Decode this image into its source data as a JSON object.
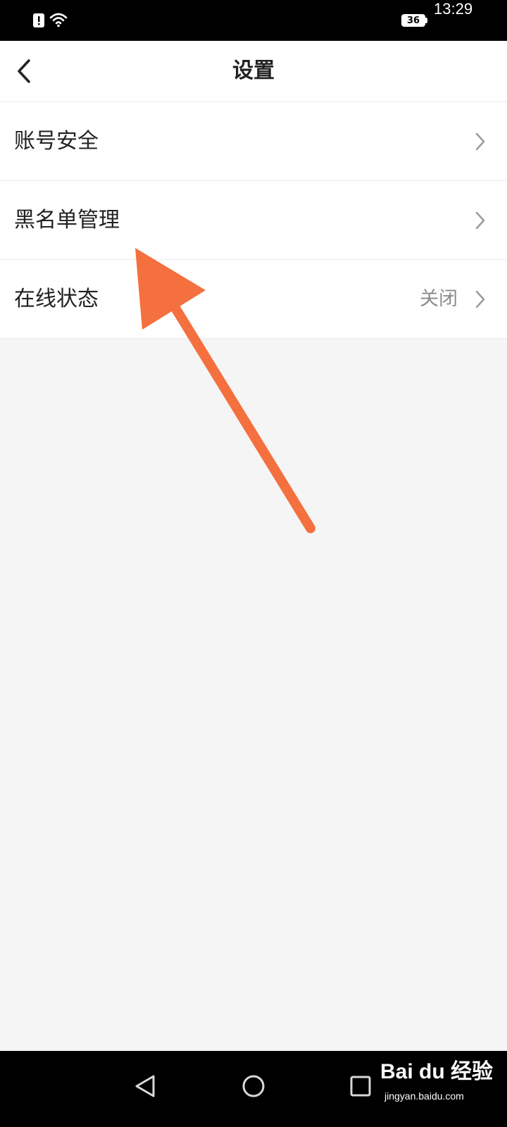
{
  "status_bar": {
    "time": "13:29",
    "battery_level": "36",
    "icons": [
      "alert-icon",
      "wifi-icon"
    ]
  },
  "header": {
    "title": "设置",
    "back_icon": "back-chevron-icon"
  },
  "settings": {
    "items": [
      {
        "label": "账号安全",
        "value": ""
      },
      {
        "label": "黑名单管理",
        "value": ""
      },
      {
        "label": "在线状态",
        "value": "关闭"
      }
    ]
  },
  "system_nav": {
    "buttons": [
      "back-triangle-icon",
      "home-circle-icon",
      "recents-square-icon"
    ]
  },
  "watermark": {
    "brand": "Bai du 经验",
    "site": "jingyan.baidu.com"
  },
  "colors": {
    "annotation_arrow": "#f4703f",
    "background": "#f5f5f5",
    "secondary_text": "#8c8c8c"
  }
}
